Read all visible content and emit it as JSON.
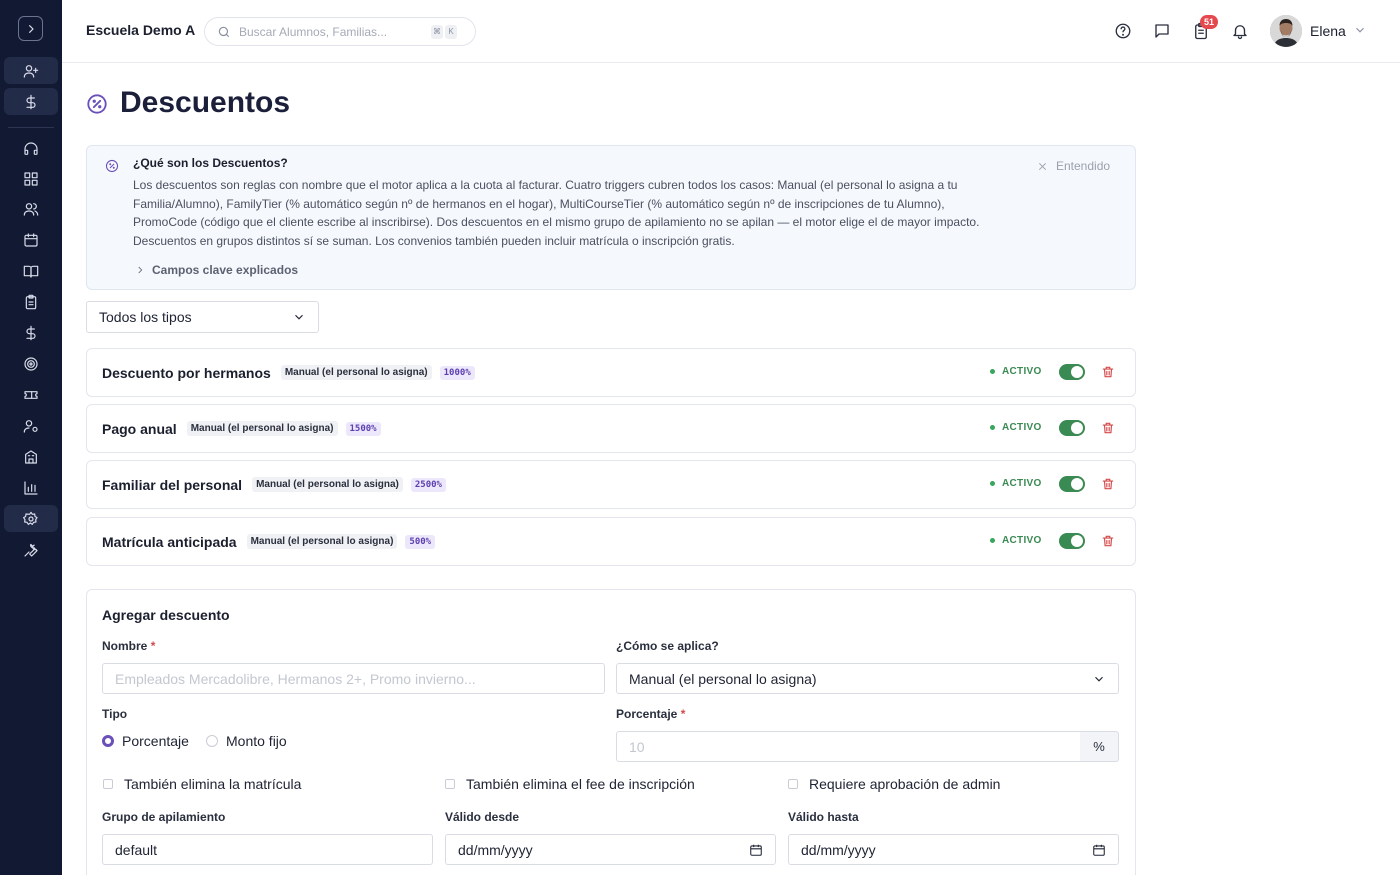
{
  "header": {
    "school_name": "Escuela Demo A",
    "search_placeholder": "Buscar Alumnos, Familias...",
    "shortcut_keys": [
      "⌘",
      "K"
    ],
    "notification_count": "51",
    "user_name": "Elena"
  },
  "page": {
    "title": "Descuentos"
  },
  "info": {
    "title": "¿Qué son los Descuentos?",
    "lines": [
      "Los descuentos son reglas con nombre que el motor aplica a la cuota al facturar. Cuatro triggers cubren todos los casos: Manual (el personal lo asigna a tu",
      "Familia/Alumno), FamilyTier (% automático según nº de hermanos en el hogar), MultiCourseTier (% automático según nº de inscripciones de tu Alumno),",
      "PromoCode (código que el cliente escribe al inscribirse). Dos descuentos en el mismo grupo de apilamiento no se apilan — el motor elige el de mayor impacto.",
      "Descuentos en grupos distintos sí se suman. Los convenios también pueden incluir matrícula o inscripción gratis."
    ],
    "dismiss_label": "Entendido",
    "more_label": "Campos clave explicados"
  },
  "filter": {
    "selected": "Todos los tipos"
  },
  "discounts": [
    {
      "name": "Descuento por hermanos",
      "trigger": "Manual (el personal lo asigna)",
      "amount": "1000%",
      "status": "ACTIVO"
    },
    {
      "name": "Pago anual",
      "trigger": "Manual (el personal lo asigna)",
      "amount": "1500%",
      "status": "ACTIVO"
    },
    {
      "name": "Familiar del personal",
      "trigger": "Manual (el personal lo asigna)",
      "amount": "2500%",
      "status": "ACTIVO"
    },
    {
      "name": "Matrícula anticipada",
      "trigger": "Manual (el personal lo asigna)",
      "amount": "500%",
      "status": "ACTIVO"
    }
  ],
  "form": {
    "title": "Agregar descuento",
    "name_label": "Nombre",
    "required_mark": "*",
    "name_placeholder": "Empleados Mercadolibre, Hermanos 2+, Promo invierno...",
    "apply_label": "¿Cómo se aplica?",
    "apply_value": "Manual (el personal lo asigna)",
    "type_label": "Tipo",
    "type_options": [
      "Porcentaje",
      "Monto fijo"
    ],
    "type_selected": "Porcentaje",
    "percent_label": "Porcentaje",
    "percent_placeholder": "10",
    "percent_suffix": "%",
    "check_matricula": "También elimina la matrícula",
    "check_fee": "También elimina el fee de inscripción",
    "check_approval": "Requiere aprobación de admin",
    "stack_label": "Grupo de apilamiento",
    "stack_value": "default",
    "valid_from_label": "Válido desde",
    "valid_from_value": "dd/mm/yyyy",
    "valid_to_label": "Válido hasta",
    "valid_to_value": "dd/mm/yyyy"
  }
}
